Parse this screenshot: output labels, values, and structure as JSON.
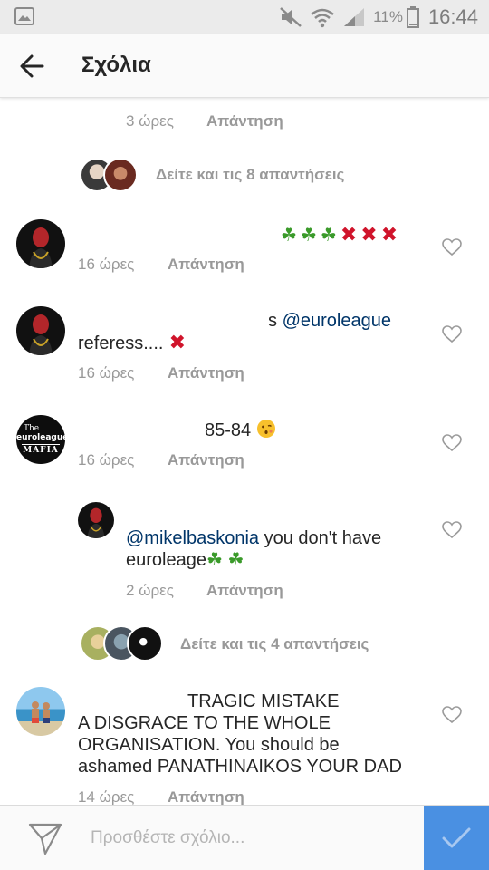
{
  "status_bar": {
    "battery_percent": "11%",
    "time": "16:44"
  },
  "header": {
    "title": "Σχόλια"
  },
  "comments": [
    {
      "time": "3 ώρες",
      "reply_label": "Απάντηση"
    },
    {
      "text_emoji": "🍀🍀🍀❌❌❌",
      "time": "16 ώρες",
      "reply_label": "Απάντηση"
    },
    {
      "text_prefix": "s ",
      "mention": "@euroleague",
      "text_line2": "referess....",
      "time": "16 ώρες",
      "reply_label": "Απάντηση"
    },
    {
      "text": "85-84",
      "time": "16 ώρες",
      "reply_label": "Απάντηση"
    },
    {
      "mention": "@mikelbaskonia",
      "text_rest": " you don't have",
      "text_line2": "euroleage",
      "time": "2 ώρες",
      "reply_label": "Απάντηση"
    },
    {
      "text_line1": "TRAGIC MISTAKE",
      "text_line2": "A DISGRACE TO THE WHOLE",
      "text_line3": "ORGANISATION. You should be",
      "text_line4": "ashamed PANATHINAIKOS YOUR DAD",
      "time": "14 ώρες",
      "reply_label": "Απάντηση"
    }
  ],
  "more_replies": [
    {
      "label": "Δείτε και τις 8 απαντήσεις"
    },
    {
      "label": "Δείτε και τις 4 απαντήσεις"
    }
  ],
  "avatar_badge": {
    "line1": "The",
    "line2": "euroleague",
    "line3": "MAFIA"
  },
  "composer": {
    "placeholder": "Προσθέστε σχόλιο..."
  },
  "colors": {
    "accent": "#4a90e2",
    "mention": "#003569",
    "meta": "#999999"
  }
}
